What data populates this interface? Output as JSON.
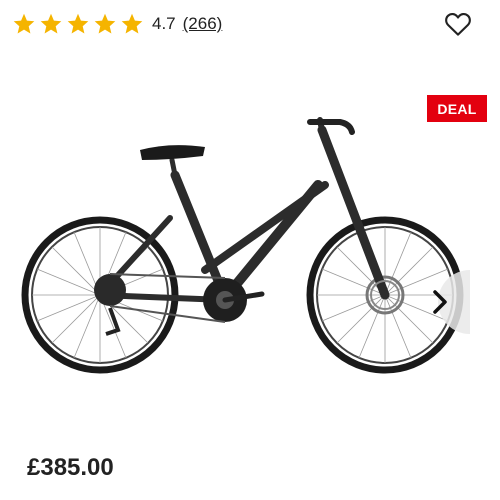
{
  "rating": {
    "stars": 5,
    "filled_stars": 5,
    "value": "4.7",
    "reviews": "(266)",
    "star_color": "#f5b400"
  },
  "wishlist": {
    "icon": "heart-outline-icon"
  },
  "badge": {
    "label": "DEAL",
    "color": "#e3000f"
  },
  "gallery": {
    "image": "bicycle-image",
    "next_icon": "chevron-right-icon"
  },
  "price": "£385.00"
}
